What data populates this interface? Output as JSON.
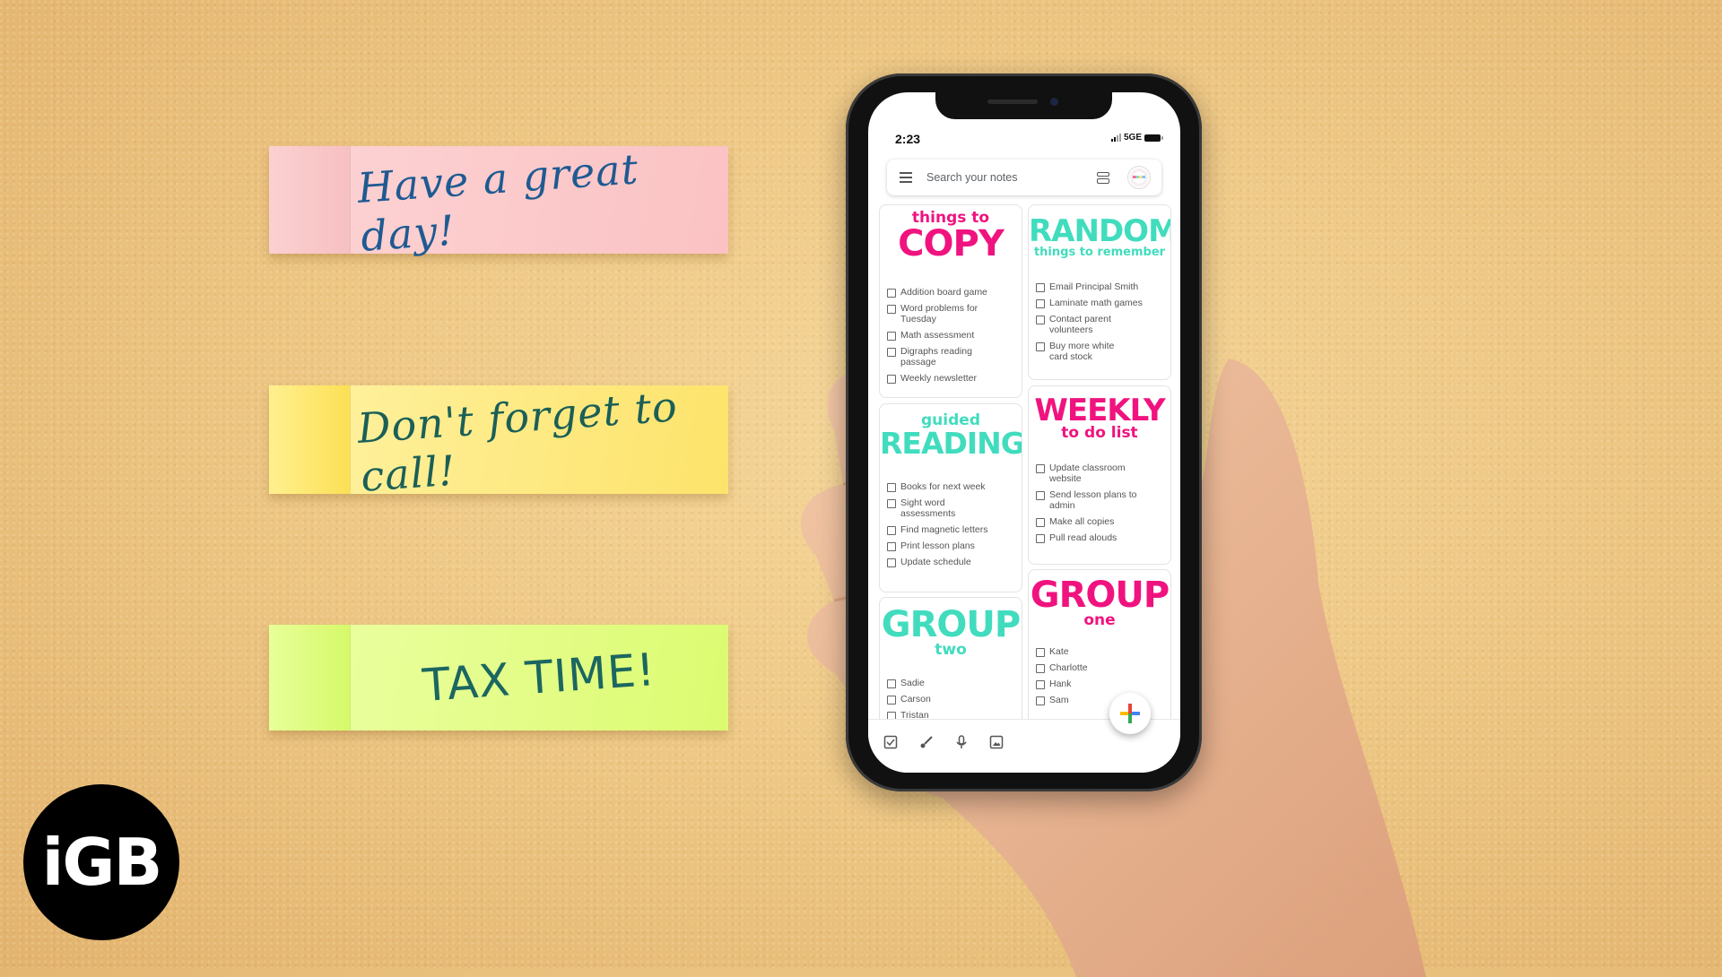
{
  "stickies": [
    {
      "text": "Have a great day!",
      "color": "#fcd4d5",
      "ink": "#1f5a92"
    },
    {
      "text": "Don't forget to call!",
      "color": "#fff3a5",
      "ink": "#1b5f57"
    },
    {
      "text": "TAX TIME!",
      "color": "#ecffa6",
      "ink": "#1b6660"
    }
  ],
  "logo": {
    "text": "iGB"
  },
  "phone": {
    "status": {
      "time": "2:23",
      "network": "5GE"
    },
    "search": {
      "placeholder": "Search your notes",
      "menu_icon": "hamburger-menu-icon",
      "layout_icon": "list-view-icon",
      "avatar_icon": "account-avatar"
    },
    "notes": [
      {
        "title_small": "things to",
        "title_big": "COPY",
        "color": "#f0137f",
        "items": [
          "Addition board game",
          "Word problems for Tuesday",
          "Math assessment",
          "Digraphs reading passage",
          "Weekly newsletter"
        ]
      },
      {
        "title_big": "RANDOM",
        "title_small": "things to remember",
        "color": "#41dcbe",
        "items": [
          "Email Principal Smith",
          "Laminate math games",
          "Contact parent volunteers",
          "Buy more white card stock"
        ]
      },
      {
        "title_small": "guided",
        "title_big": "READING",
        "color": "#41dcbe",
        "items": [
          "Books for next week",
          "Sight word assessments",
          "Find magnetic letters",
          "Print lesson plans",
          "Update schedule"
        ]
      },
      {
        "title_big": "WEEKLY",
        "title_small": "to do list",
        "color": "#f0137f",
        "items": [
          "Update classroom website",
          "Send lesson plans to admin",
          "Make all copies",
          "Pull read alouds"
        ]
      },
      {
        "title_big": "GROUP",
        "title_small": "two",
        "color": "#41dcbe",
        "items": [
          "Sadie",
          "Carson",
          "Tristan"
        ]
      },
      {
        "title_big": "GROUP",
        "title_small": "one",
        "color": "#f0137f",
        "items": [
          "Kate",
          "Charlotte",
          "Hank",
          "Sam"
        ]
      }
    ],
    "bottom_bar": [
      "checkbox-icon",
      "brush-icon",
      "microphone-icon",
      "image-icon"
    ],
    "fab": "new-note-plus-icon"
  }
}
